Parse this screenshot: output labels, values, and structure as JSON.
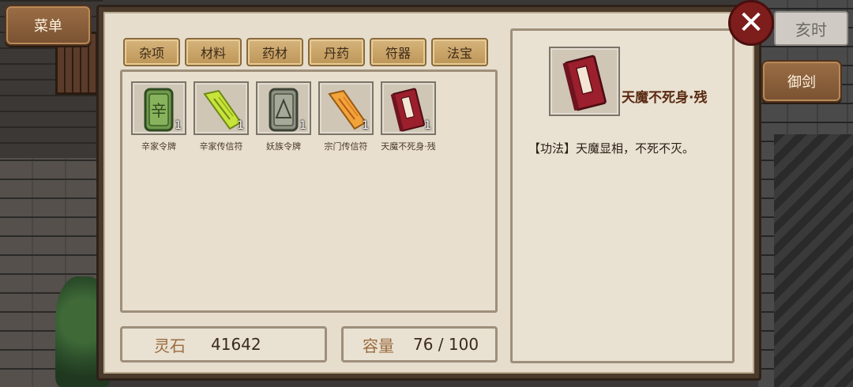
{
  "sidebar": {
    "menu_label": "菜单",
    "sword_label": "御剑",
    "time_label": "亥时"
  },
  "close": {
    "glyph": "✕"
  },
  "tabs": [
    {
      "label": "杂项"
    },
    {
      "label": "材料"
    },
    {
      "label": "药材"
    },
    {
      "label": "丹药"
    },
    {
      "label": "符器"
    },
    {
      "label": "法宝"
    }
  ],
  "items": [
    {
      "name": "辛家令牌",
      "count": "1",
      "icon": "jade-token-icon",
      "glyph": "辛"
    },
    {
      "name": "辛家传信符",
      "count": "1",
      "icon": "green-talisman-scroll-icon"
    },
    {
      "name": "妖族令牌",
      "count": "1",
      "icon": "stone-token-icon"
    },
    {
      "name": "宗门传信符",
      "count": "1",
      "icon": "orange-talisman-scroll-icon"
    },
    {
      "name": "天魔不死身·残",
      "count": "1",
      "icon": "red-book-icon"
    }
  ],
  "footer": {
    "stone_label": "灵石",
    "stone_value": "41642",
    "capacity_label": "容量",
    "capacity_value": "76 / 100"
  },
  "detail": {
    "icon": "red-book-icon",
    "name": "天魔不死身·残",
    "description": "【功法】天魔显相，不死不灭。"
  },
  "colors": {
    "panel_bg": "#e6ddcd",
    "tab_gold": "#c9a468",
    "close_red": "#7d1d1c",
    "title_brown": "#5a2a12",
    "label_brown": "#9a6b3e"
  }
}
